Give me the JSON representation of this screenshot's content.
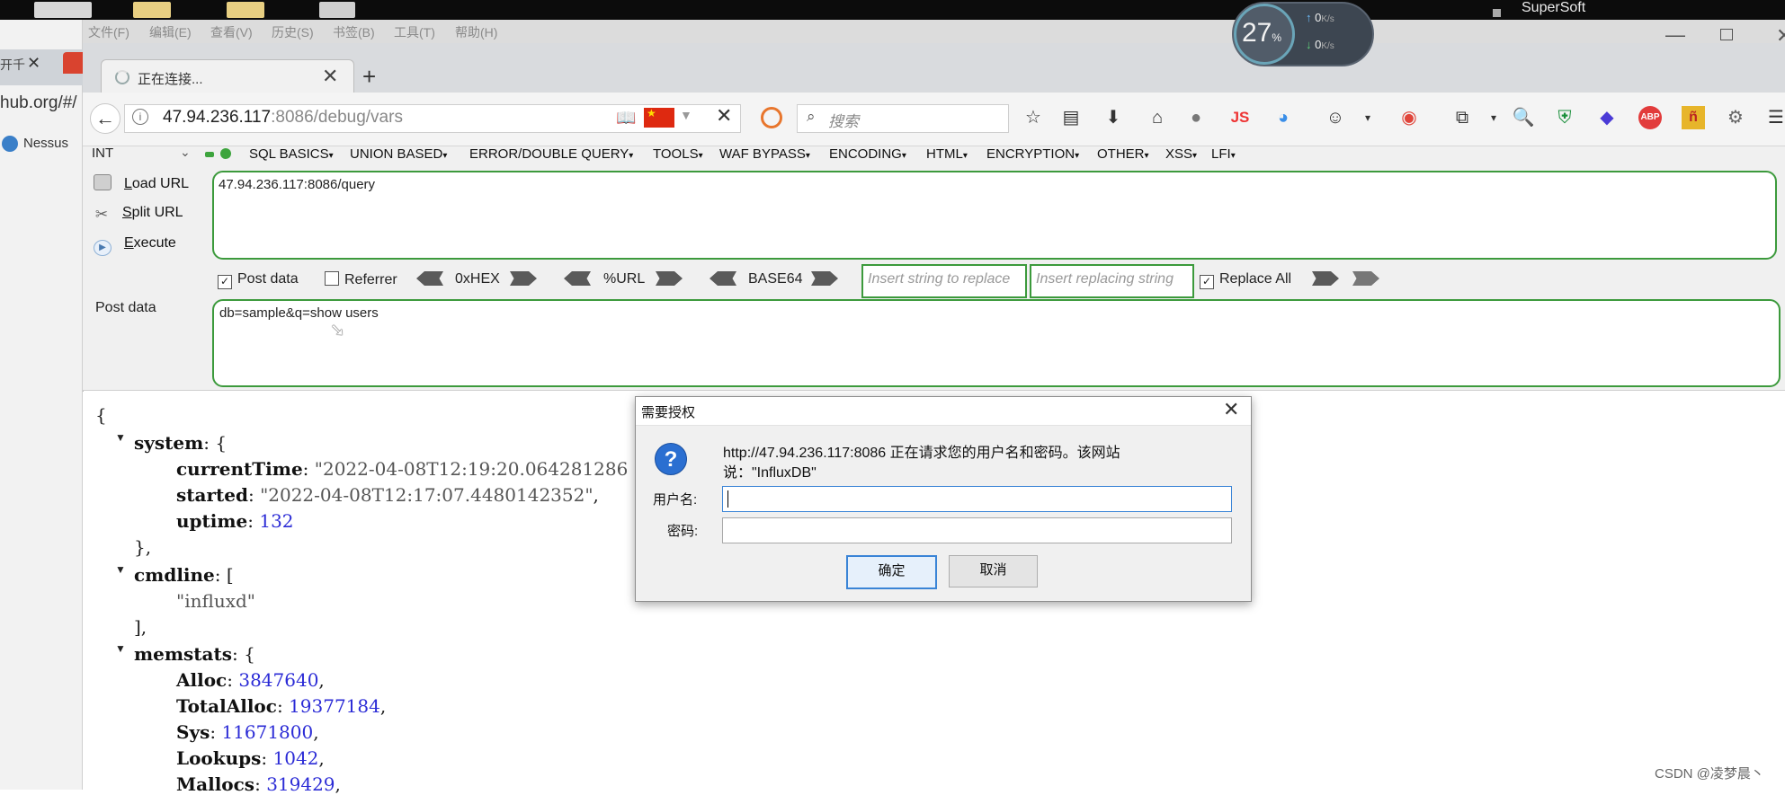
{
  "menu": [
    "文件(F)",
    "编辑(E)",
    "查看(V)",
    "历史(S)",
    "书签(B)",
    "工具(T)",
    "帮助(H)"
  ],
  "tab": {
    "title": "正在连接..."
  },
  "background": {
    "tab_text": "开千",
    "url_fragment": "hub.org/#/",
    "bookmark": "Nessus"
  },
  "speed": {
    "percent": "27",
    "percent_sign": "%",
    "up": "0",
    "down": "0",
    "unit": "K/s"
  },
  "taskbar": {
    "app": "SuperSoft"
  },
  "address": {
    "host": "47.94.236.117",
    "rest": ":8086/debug/vars"
  },
  "search": {
    "placeholder": "搜索"
  },
  "hackbar": {
    "select": "INT",
    "menus": [
      "SQL BASICS",
      "UNION BASED",
      "ERROR/DOUBLE QUERY",
      "TOOLS",
      "WAF BYPASS",
      "ENCODING",
      "HTML",
      "ENCRYPTION",
      "OTHER",
      "XSS",
      "LFI"
    ],
    "load_url": {
      "first": "L",
      "rest": "oad URL"
    },
    "split_url": {
      "first": "S",
      "rest": "plit URL"
    },
    "execute": {
      "first": "E",
      "rest": "xecute"
    },
    "url_value": "47.94.236.117:8086/query",
    "post_data_check": "Post data",
    "post_data_checked": true,
    "referrer": "Referrer",
    "referrer_checked": false,
    "hex": "0xHEX",
    "url_enc": "%URL",
    "base64": "BASE64",
    "insert_replace_ph": "Insert string to replace",
    "insert_replacing_ph": "Insert replacing string",
    "replace_all": "Replace All",
    "replace_all_checked": true,
    "post_label": "Post data",
    "post_value": "db=sample&q=show users"
  },
  "json": {
    "open_brace": "{",
    "system_key": "system",
    "current_time_key": "currentTime",
    "current_time_val": "\"2022-04-08T12:19:20.064281286",
    "started_key": "started",
    "started_val": "\"2022-04-08T12:17:07.4480142352\"",
    "uptime_key": "uptime",
    "uptime_val": "132",
    "close_obj": "},",
    "cmdline_key": "cmdline",
    "cmdline_item": "\"influxd\"",
    "close_arr": "],",
    "memstats_key": "memstats",
    "alloc_key": "Alloc",
    "alloc_val": "3847640",
    "total_alloc_key": "TotalAlloc",
    "total_alloc_val": "19377184",
    "sys_key": "Sys",
    "sys_val": "11671800",
    "lookups_key": "Lookups",
    "lookups_val": "1042",
    "mallocs_key": "Mallocs",
    "mallocs_val": "319429"
  },
  "dialog": {
    "title": "需要授权",
    "msg_line1": "http://47.94.236.117:8086 正在请求您的用户名和密码。该网站",
    "msg_line2": "说：\"InfluxDB\"",
    "user_label": "用户名:",
    "pass_label": "密码:",
    "ok": "确定",
    "cancel": "取消"
  },
  "watermark": "CSDN @凌梦晨丶"
}
